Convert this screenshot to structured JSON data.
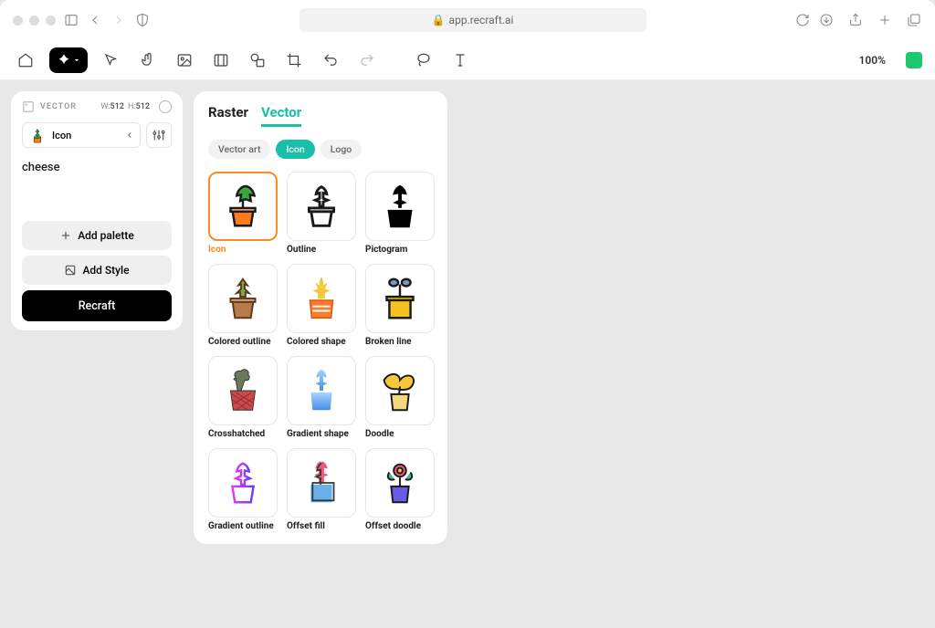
{
  "browser": {
    "url": "app.recraft.ai"
  },
  "toolbar": {
    "zoom": "100%"
  },
  "sidebar": {
    "mode": "VECTOR",
    "wlabel": "W:",
    "wval": "512",
    "hlabel": "H:",
    "hval": "512",
    "style_label": "Icon",
    "prompt": "cheese",
    "add_palette": "Add palette",
    "add_style": "Add Style",
    "recraft": "Recraft"
  },
  "panel": {
    "tabs": [
      "Raster",
      "Vector"
    ],
    "active_tab": "Vector",
    "chips": [
      "Vector art",
      "Icon",
      "Logo"
    ],
    "active_chip": "Icon",
    "styles": [
      {
        "label": "Icon",
        "selected": true
      },
      {
        "label": "Outline"
      },
      {
        "label": "Pictogram"
      },
      {
        "label": "Colored outline"
      },
      {
        "label": "Colored shape"
      },
      {
        "label": "Broken line"
      },
      {
        "label": "Crosshatched"
      },
      {
        "label": "Gradient shape"
      },
      {
        "label": "Doodle"
      },
      {
        "label": "Gradient outline"
      },
      {
        "label": "Offset fill"
      },
      {
        "label": "Offset doodle"
      }
    ]
  }
}
